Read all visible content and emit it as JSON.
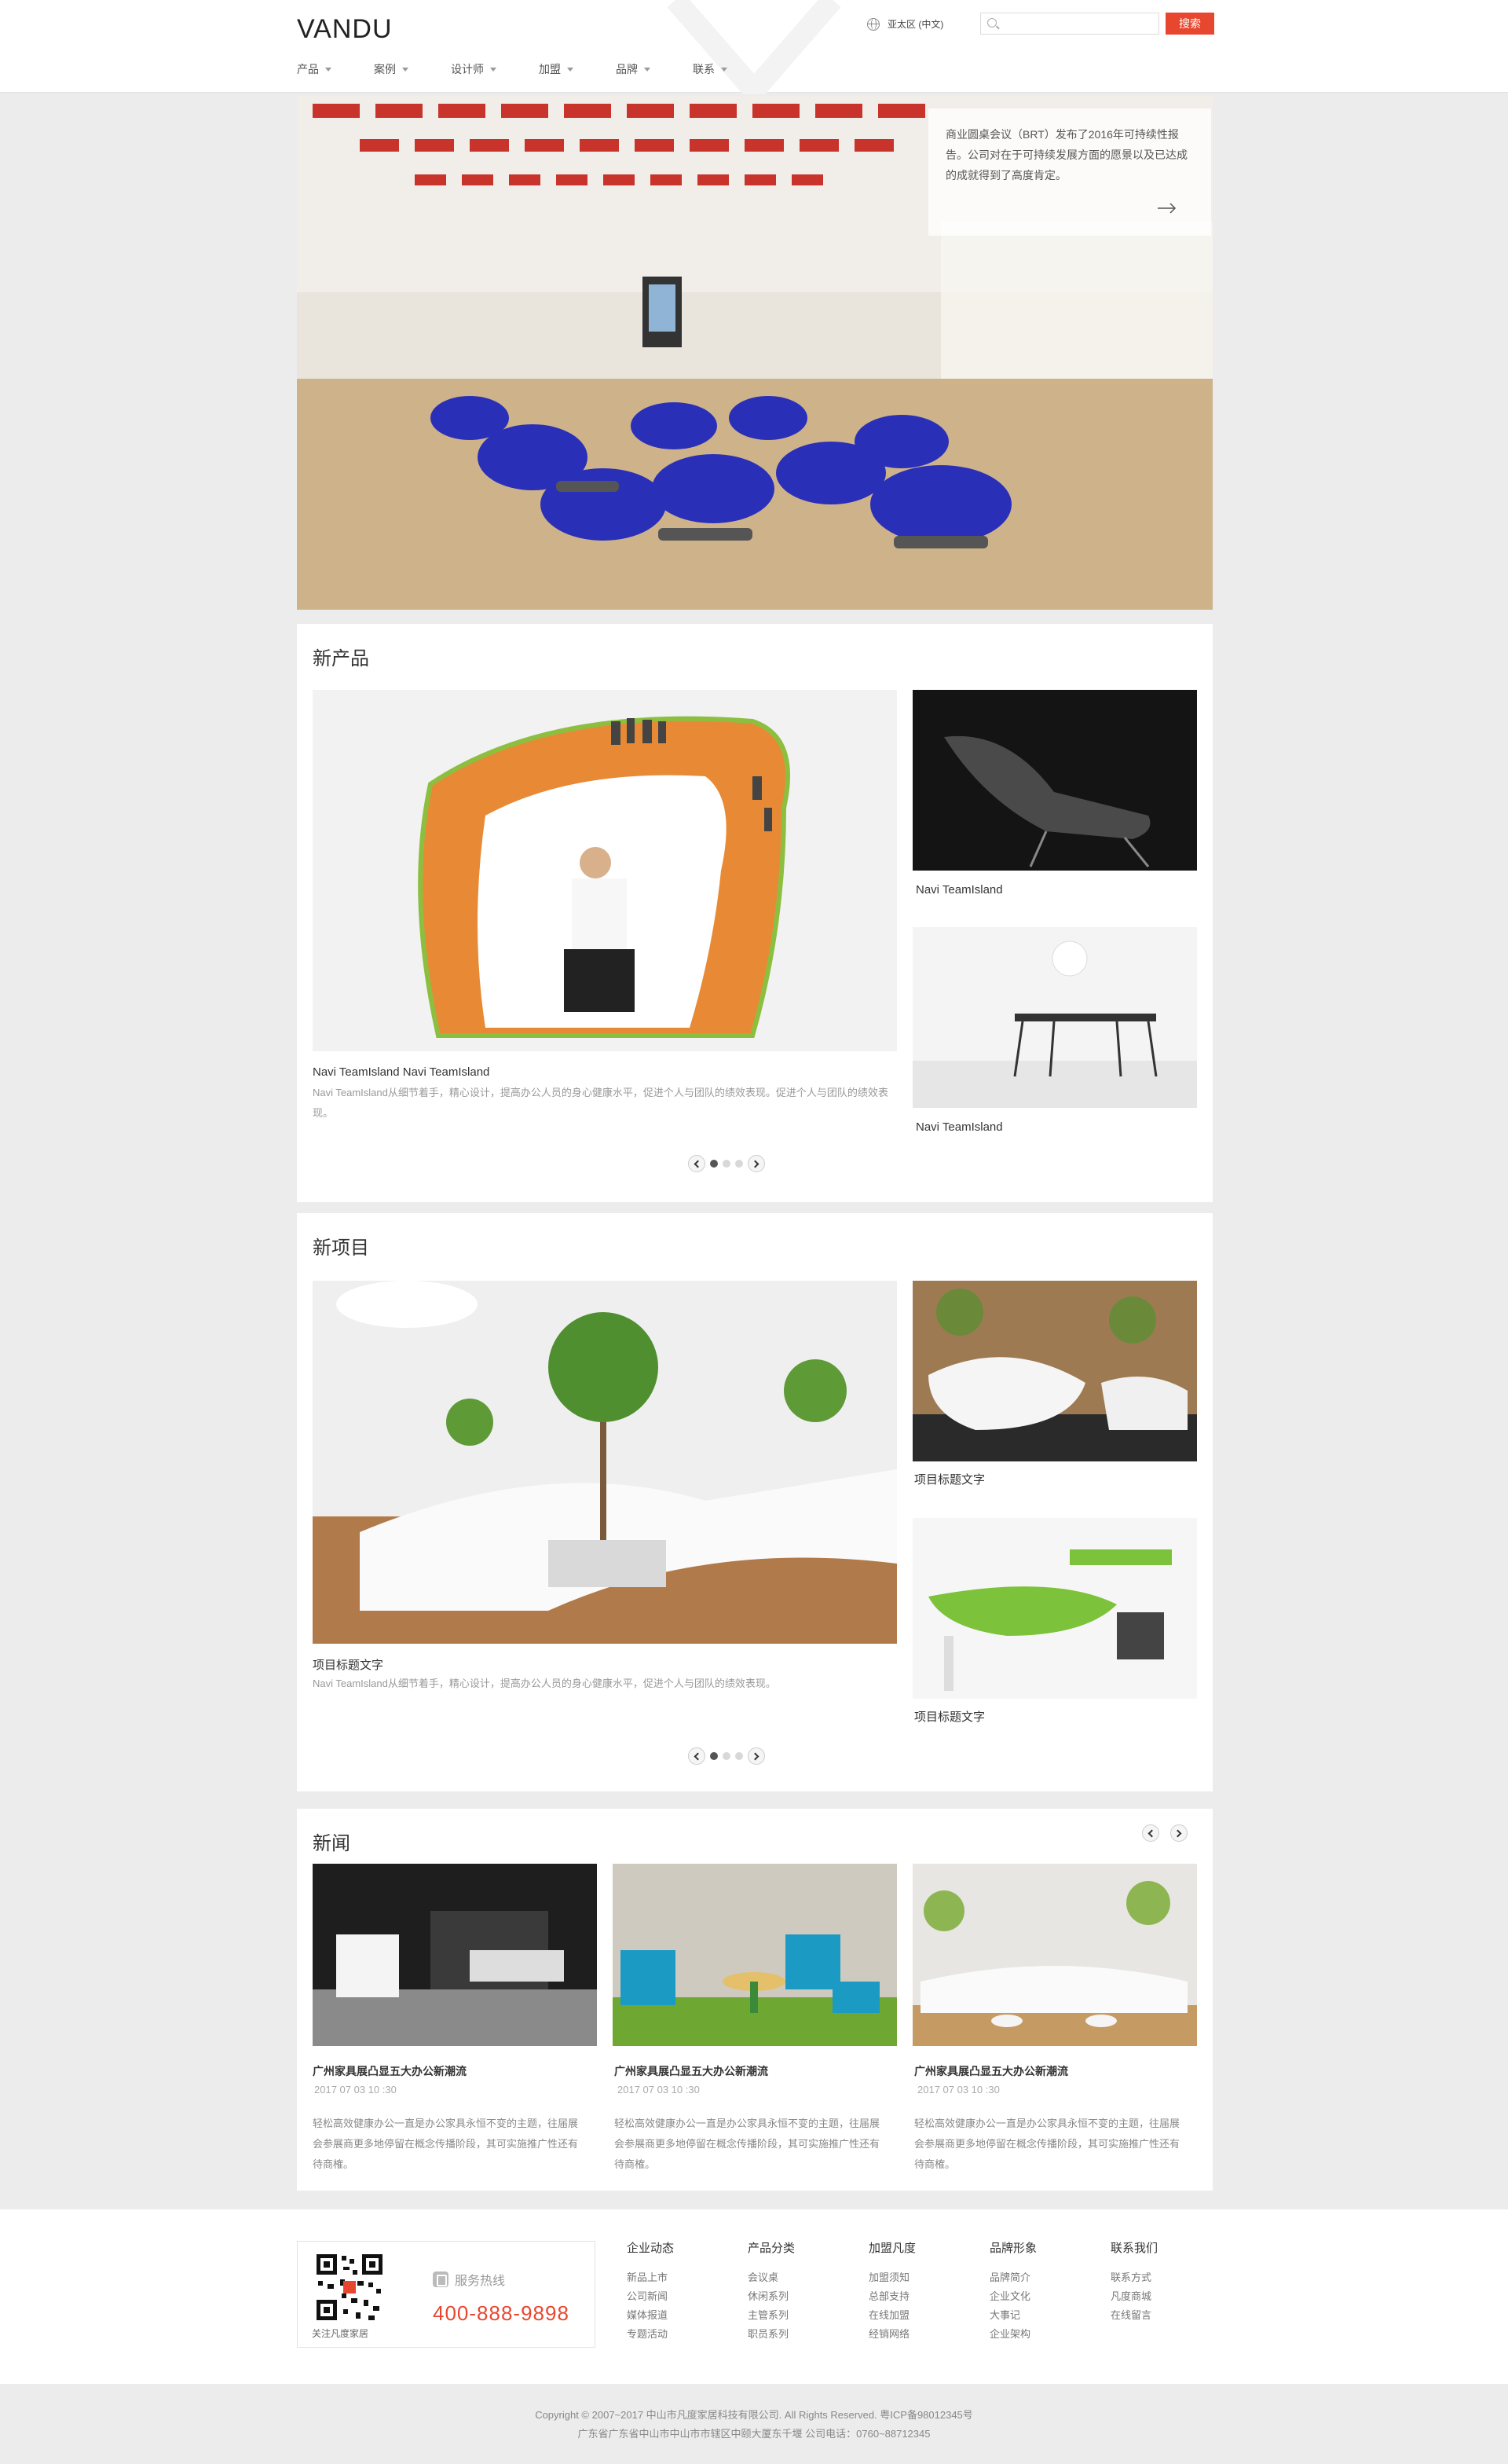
{
  "header": {
    "logo": "VANDU",
    "region": "亚太区 (中文)",
    "search_placeholder": "",
    "search_button": "搜索",
    "nav": [
      {
        "label": "产品"
      },
      {
        "label": "案例"
      },
      {
        "label": "设计师"
      },
      {
        "label": "加盟"
      },
      {
        "label": "品牌"
      },
      {
        "label": "联系"
      }
    ]
  },
  "hero": {
    "text": "商业圆桌会议（BRT）发布了2016年可持续性报告。公司对在于可持续发展方面的愿景以及已达成的成就得到了高度肯定。"
  },
  "new_products": {
    "title": "新产品",
    "main_caption": "Navi TeamIsland  Navi TeamIsland",
    "main_desc": "Navi TeamIsland从细节着手，精心设计，提高办公人员的身心健康水平，促进个人与团队的绩效表现。促进个人与团队的绩效表现。",
    "side_captions": [
      "Navi TeamIsland",
      "Navi TeamIsland"
    ]
  },
  "new_projects": {
    "title": "新项目",
    "main_caption": "项目标题文字",
    "main_desc": "Navi TeamIsland从细节着手，精心设计，提高办公人员的身心健康水平，促进个人与团队的绩效表现。",
    "side_captions": [
      "项目标题文字",
      "项目标题文字"
    ]
  },
  "news": {
    "title": "新闻",
    "items": [
      {
        "title": "广州家具展凸显五大办公新潮流",
        "date": "2017 07 03 10 :30",
        "body": "轻松高效健康办公一直是办公家具永恒不变的主题，往届展会参展商更多地停留在概念传播阶段，其可实施推广性还有待商榷。"
      },
      {
        "title": "广州家具展凸显五大办公新潮流",
        "date": "2017 07 03 10 :30",
        "body": "轻松高效健康办公一直是办公家具永恒不变的主题，往届展会参展商更多地停留在概念传播阶段，其可实施推广性还有待商榷。"
      },
      {
        "title": "广州家具展凸显五大办公新潮流",
        "date": "2017 07 03 10 :30",
        "body": "轻松高效健康办公一直是办公家具永恒不变的主题，往届展会参展商更多地停留在概念传播阶段，其可实施推广性还有待商榷。"
      }
    ]
  },
  "footer": {
    "qr_caption": "关注凡度家居",
    "hotline_label": "服务热线",
    "hotline_number": "400-888-9898",
    "columns": [
      {
        "title": "企业动态",
        "links": [
          "新品上市",
          "公司新闻",
          "媒体报道",
          "专题活动"
        ]
      },
      {
        "title": "产品分类",
        "links": [
          "会议桌",
          "休闲系列",
          "主管系列",
          "职员系列"
        ]
      },
      {
        "title": "加盟凡度",
        "links": [
          "加盟须知",
          "总部支持",
          "在线加盟",
          "经销网络"
        ]
      },
      {
        "title": "品牌形象",
        "links": [
          "品牌简介",
          "企业文化",
          "大事记",
          "企业架构"
        ]
      },
      {
        "title": "联系我们",
        "links": [
          "联系方式",
          "凡度商城",
          "在线留言"
        ]
      }
    ]
  },
  "copyright": {
    "line1": "Copyright © 2007~2017 中山市凡度家居科技有限公司. All Rights Reserved.    粤ICP备98012345号",
    "line2": "广东省广东省中山市中山市市辖区中颐大厦东千堰  公司电话：0760~88712345"
  },
  "colors": {
    "accent": "#e8472f",
    "page_bg": "#ececec",
    "panel_bg": "#ffffff"
  }
}
